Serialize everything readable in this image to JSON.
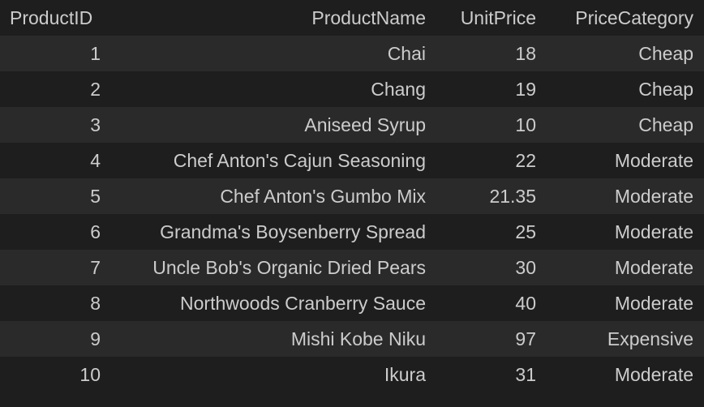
{
  "table": {
    "columns": [
      "ProductID",
      "ProductName",
      "UnitPrice",
      "PriceCategory"
    ],
    "rows": [
      [
        "1",
        "Chai",
        "18",
        "Cheap"
      ],
      [
        "2",
        "Chang",
        "19",
        "Cheap"
      ],
      [
        "3",
        "Aniseed Syrup",
        "10",
        "Cheap"
      ],
      [
        "4",
        "Chef Anton's Cajun Seasoning",
        "22",
        "Moderate"
      ],
      [
        "5",
        "Chef Anton's Gumbo Mix",
        "21.35",
        "Moderate"
      ],
      [
        "6",
        "Grandma's Boysenberry Spread",
        "25",
        "Moderate"
      ],
      [
        "7",
        "Uncle Bob's Organic Dried Pears",
        "30",
        "Moderate"
      ],
      [
        "8",
        "Northwoods Cranberry Sauce",
        "40",
        "Moderate"
      ],
      [
        "9",
        "Mishi Kobe Niku",
        "97",
        "Expensive"
      ],
      [
        "10",
        "Ikura",
        "31",
        "Moderate"
      ]
    ]
  },
  "colors": {
    "background": "#1e1e1e",
    "row_stripe": "#2a2a2a",
    "text": "#cccccc"
  }
}
